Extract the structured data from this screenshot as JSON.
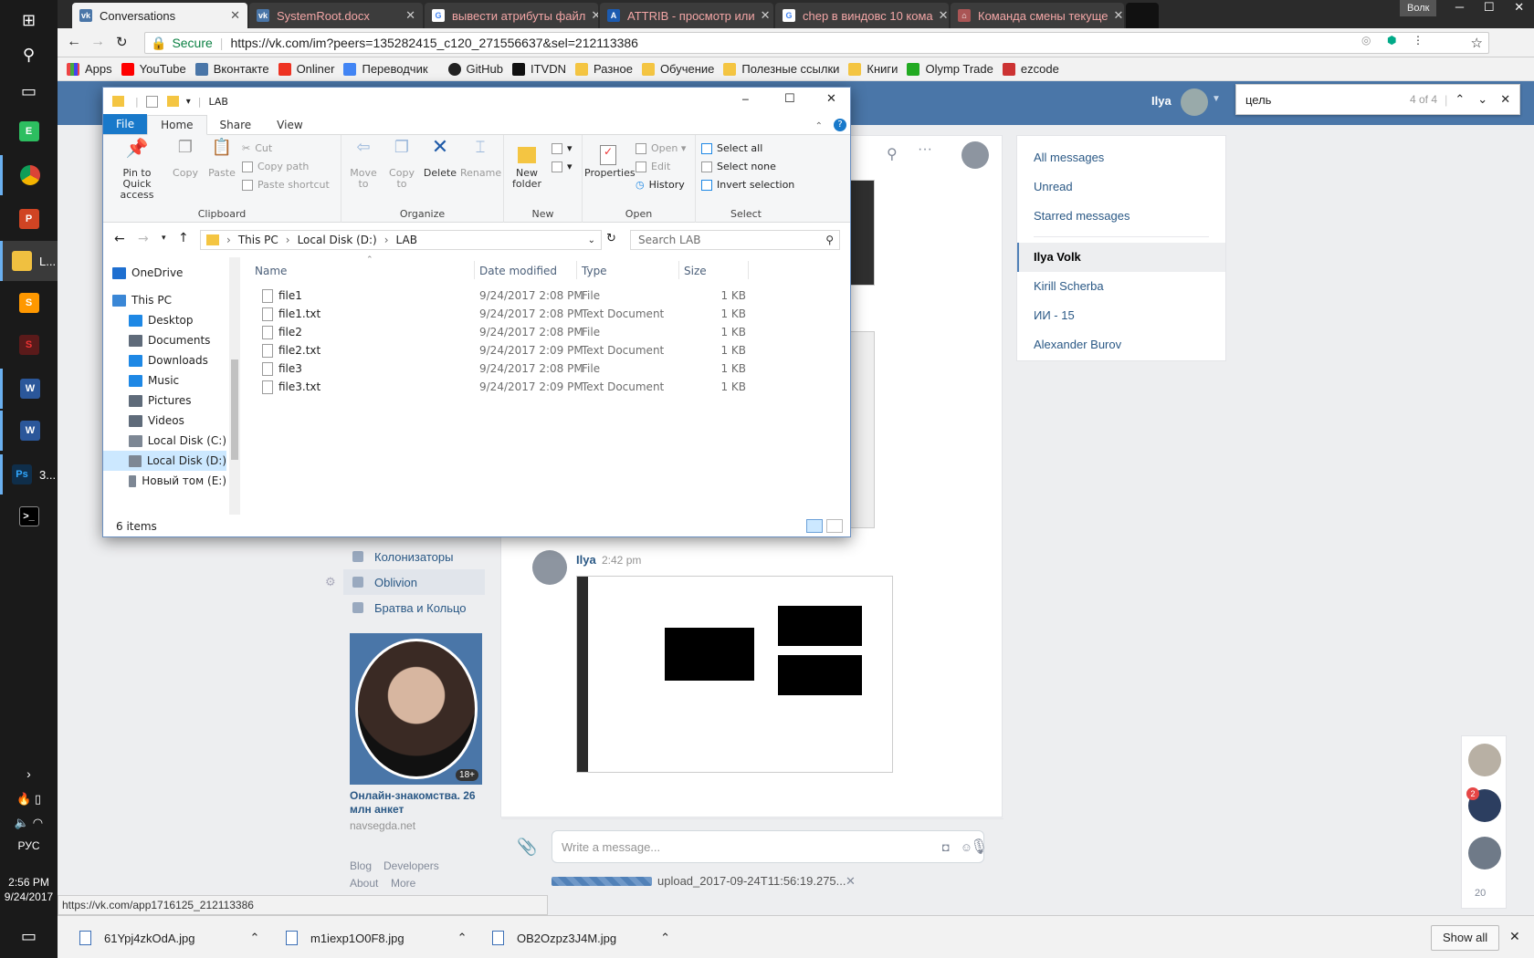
{
  "taskbar": {
    "items": [
      {
        "icon": "windows-start-icon"
      },
      {
        "icon": "search-icon"
      },
      {
        "icon": "task-view-icon"
      },
      {
        "icon": "evernote-icon"
      },
      {
        "icon": "chrome-icon"
      },
      {
        "icon": "powerpoint-icon"
      },
      {
        "label": "L...",
        "icon": "file-explorer-icon"
      },
      {
        "icon": "sublime-icon"
      },
      {
        "icon": "app-s-icon"
      },
      {
        "icon": "word-icon"
      },
      {
        "icon": "word-icon"
      },
      {
        "label": "3...",
        "icon": "photoshop-icon"
      },
      {
        "icon": "cmd-icon"
      }
    ],
    "lang": "РУС",
    "time": "2:56 PM",
    "date": "9/24/2017"
  },
  "chrome": {
    "tabs": [
      {
        "title": "Conversations",
        "active": true
      },
      {
        "title": "SystemRoot.docx"
      },
      {
        "title": "вывести атрибуты файл"
      },
      {
        "title": "ATTRIB - просмотр или"
      },
      {
        "title": "chep в виндовс 10 кома"
      },
      {
        "title": "Команда смены текуще"
      }
    ],
    "profile": "Волк",
    "secure_label": "Secure",
    "url": "https://vk.com/im?peers=135282415_c120_271556637&sel=212113386",
    "bookmarks": [
      "Apps",
      "YouTube",
      "Вконтакте",
      "Onliner",
      "Переводчик",
      "GitHub",
      "ITVDN",
      "Разное",
      "Обучение",
      "Полезные ссылки",
      "Книги",
      "Olymp Trade",
      "ezcode"
    ]
  },
  "find": {
    "query": "цель",
    "count": "4 of 4"
  },
  "vk": {
    "user": "Ilya",
    "filters": [
      "All messages",
      "Unread",
      "Starred messages"
    ],
    "dialogs": [
      {
        "name": "Ilya Volk",
        "selected": true
      },
      {
        "name": "Kirill Scherba"
      },
      {
        "name": "ИИ - 15"
      },
      {
        "name": "Alexander Burov"
      }
    ],
    "left_nav": [
      "Колонизаторы",
      "Oblivion",
      "Братва и Кольцо"
    ],
    "ad": {
      "title": "Онлайн-знакомства. 26 млн анкет",
      "domain": "navsegda.net",
      "badge": "18+"
    },
    "footer_links": [
      "Blog",
      "Developers",
      "About",
      "More"
    ],
    "message": {
      "author": "Ilya",
      "time": "2:42 pm"
    },
    "composer_placeholder": "Write a message...",
    "upload_name": "upload_2017-09-24T11:56:19.275...",
    "online_count": "20",
    "badge_count": "2"
  },
  "status_url": "https://vk.com/app1716125_212113386",
  "downloads": [
    "61Ypj4zkOdA.jpg",
    "m1iexp1O0F8.jpg",
    "OB2Ozpz3J4M.jpg"
  ],
  "show_all": "Show all",
  "explorer": {
    "title": "LAB",
    "tabs": [
      "File",
      "Home",
      "Share",
      "View"
    ],
    "clipboard": {
      "pin": "Pin to Quick access",
      "copy": "Copy",
      "paste": "Paste",
      "cut": "Cut",
      "copy_path": "Copy path",
      "paste_shortcut": "Paste shortcut",
      "label": "Clipboard"
    },
    "organize": {
      "move": "Move to",
      "copy": "Copy to",
      "delete": "Delete",
      "rename": "Rename",
      "label": "Organize"
    },
    "new": {
      "folder": "New folder",
      "label": "New"
    },
    "open": {
      "properties": "Properties",
      "open": "Open",
      "edit": "Edit",
      "history": "History",
      "label": "Open"
    },
    "select": {
      "all": "Select all",
      "none": "Select none",
      "invert": "Invert selection",
      "label": "Select"
    },
    "breadcrumb": [
      "This PC",
      "Local Disk (D:)",
      "LAB"
    ],
    "search_placeholder": "Search LAB",
    "tree": [
      {
        "name": "OneDrive",
        "color": "#1e6fd0"
      },
      {
        "name": "This PC",
        "color": "#3a87d6"
      },
      {
        "name": "Desktop",
        "color": "#1e88e5"
      },
      {
        "name": "Documents",
        "color": "#5f6b7a"
      },
      {
        "name": "Downloads",
        "color": "#1e88e5"
      },
      {
        "name": "Music",
        "color": "#1e88e5"
      },
      {
        "name": "Pictures",
        "color": "#5f6b7a"
      },
      {
        "name": "Videos",
        "color": "#5f6b7a"
      },
      {
        "name": "Local Disk (C:)",
        "color": "#7d8794"
      },
      {
        "name": "Local Disk (D:)",
        "color": "#7d8794",
        "selected": true
      },
      {
        "name": "Новый том (E:)",
        "color": "#7d8794"
      }
    ],
    "columns": [
      "Name",
      "Date modified",
      "Type",
      "Size"
    ],
    "files": [
      {
        "name": "file1",
        "date": "9/24/2017 2:08 PM",
        "type": "File",
        "size": "1 KB"
      },
      {
        "name": "file1.txt",
        "date": "9/24/2017 2:08 PM",
        "type": "Text Document",
        "size": "1 KB"
      },
      {
        "name": "file2",
        "date": "9/24/2017 2:08 PM",
        "type": "File",
        "size": "1 KB"
      },
      {
        "name": "file2.txt",
        "date": "9/24/2017 2:09 PM",
        "type": "Text Document",
        "size": "1 KB"
      },
      {
        "name": "file3",
        "date": "9/24/2017 2:08 PM",
        "type": "File",
        "size": "1 KB"
      },
      {
        "name": "file3.txt",
        "date": "9/24/2017 2:09 PM",
        "type": "Text Document",
        "size": "1 KB"
      }
    ],
    "status": "6 items"
  },
  "colors": {
    "vk_blue": "#4a76a8",
    "explorer_accent": "#1979ca",
    "chrome_dark": "#2b2b2b"
  }
}
